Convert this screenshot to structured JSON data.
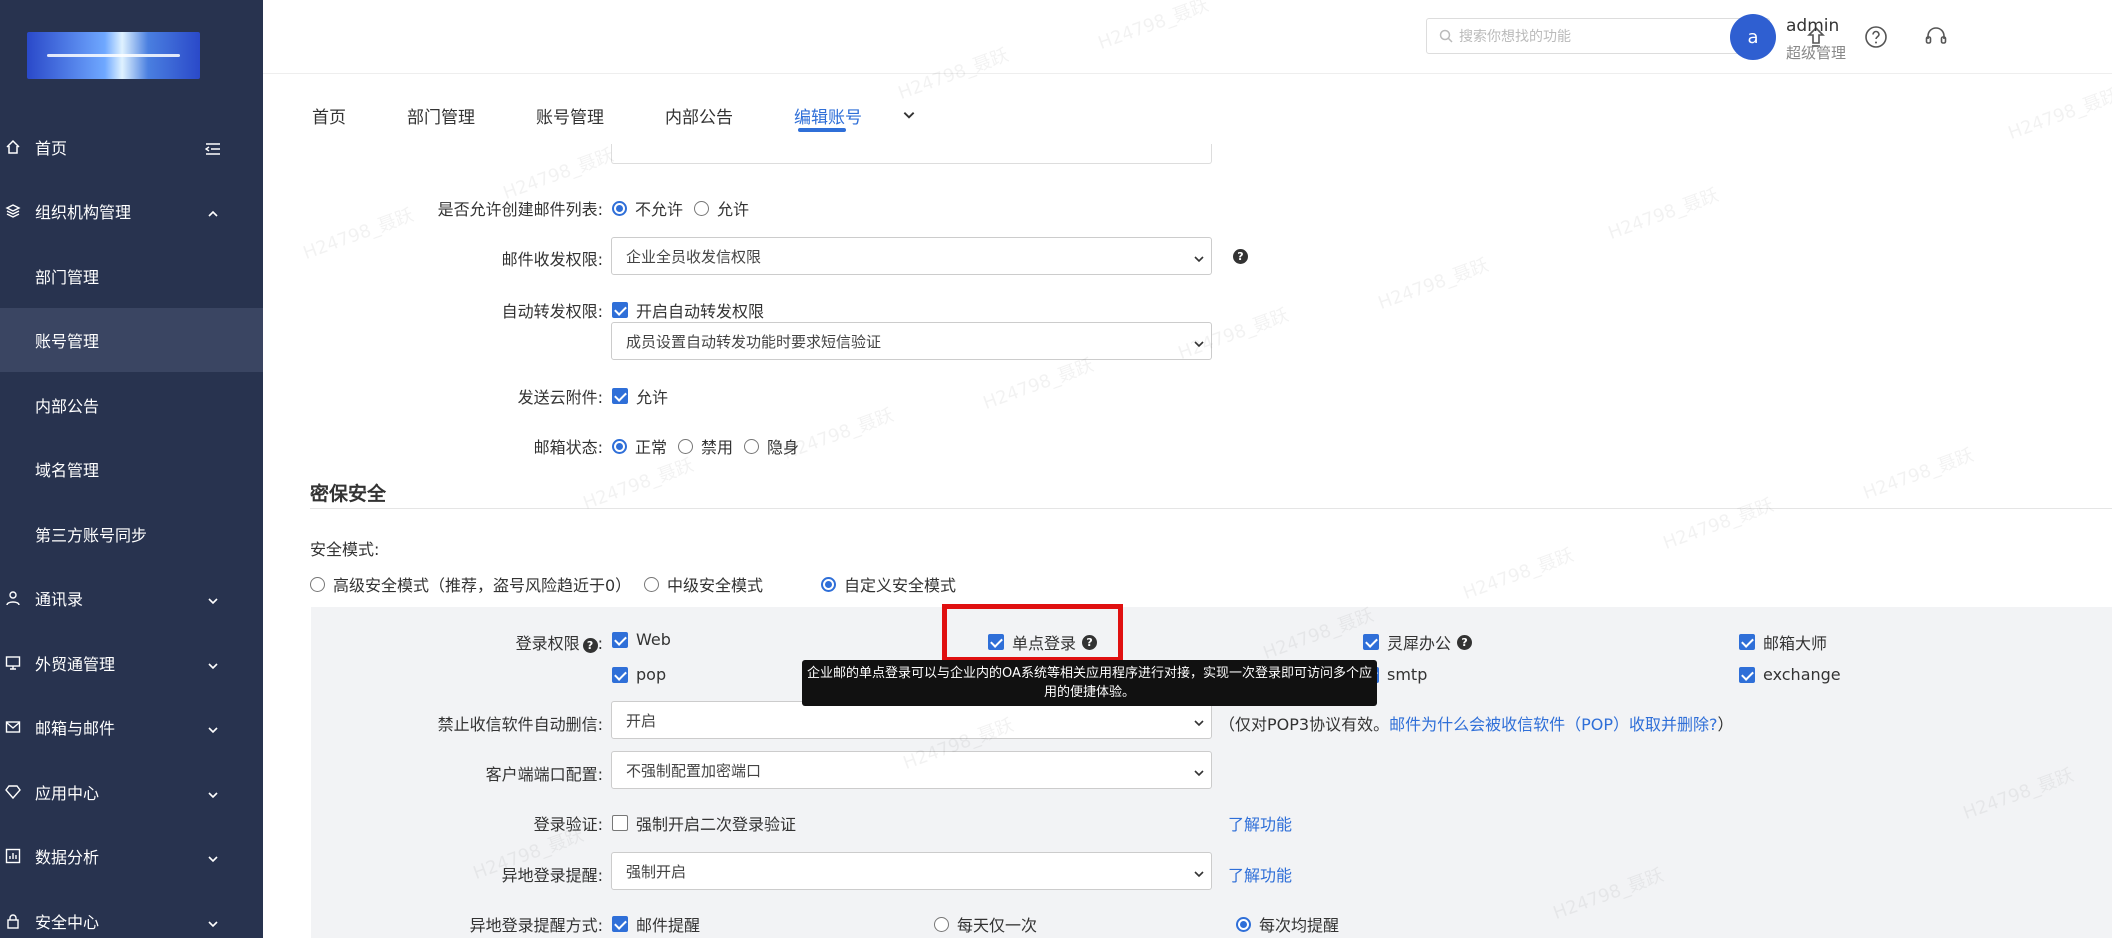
{
  "header": {
    "search_placeholder": "搜索你想找的功能",
    "avatar_letter": "a",
    "user_name": "admin",
    "user_role": "超级管理"
  },
  "sidebar": {
    "items": [
      {
        "label": "首页",
        "icon": "home-icon"
      },
      {
        "label": "组织机构管理",
        "icon": "layers-icon"
      },
      {
        "label": "部门管理"
      },
      {
        "label": "账号管理"
      },
      {
        "label": "内部公告"
      },
      {
        "label": "域名管理"
      },
      {
        "label": "第三方账号同步"
      },
      {
        "label": "通讯录",
        "icon": "person-icon"
      },
      {
        "label": "外贸通管理",
        "icon": "monitor-icon"
      },
      {
        "label": "邮箱与邮件",
        "icon": "mail-icon"
      },
      {
        "label": "应用中心",
        "icon": "diamond-icon"
      },
      {
        "label": "数据分析",
        "icon": "chart-icon"
      },
      {
        "label": "安全中心",
        "icon": "lock-icon"
      }
    ]
  },
  "tabs": [
    "首页",
    "部门管理",
    "账号管理",
    "内部公告",
    "编辑账号"
  ],
  "form": {
    "create_list_label": "是否允许创建邮件列表:",
    "create_list_opts": [
      "不允许",
      "允许"
    ],
    "mail_perm_label": "邮件收发权限:",
    "mail_perm_value": "企业全员收发信权限",
    "forward_label": "自动转发权限:",
    "forward_cb": "开启自动转发权限",
    "forward_select": "成员设置自动转发功能时要求短信验证",
    "cloud_label": "发送云附件:",
    "cloud_cb": "允许",
    "status_label": "邮箱状态:",
    "status_opts": [
      "正常",
      "禁用",
      "隐身"
    ]
  },
  "security": {
    "title": "密保安全",
    "mode_label": "安全模式:",
    "modes": [
      "高级安全模式（推荐，盗号风险趋近于0）",
      "中级安全模式",
      "自定义安全模式"
    ],
    "login_perm_label": "登录权限",
    "login_perms": [
      "Web",
      "单点登录",
      "灵犀办公",
      "邮箱大师",
      "pop",
      "smtp",
      "exchange"
    ],
    "tooltip": "企业邮的单点登录可以与企业内的OA系统等相关应用程序进行对接，实现一次登录即可访问多个应用的便捷体验。",
    "no_delete_label": "禁止收信软件自动删信:",
    "no_delete_value": "开启",
    "no_delete_note_prefix": "（仅对POP3协议有效。",
    "no_delete_link": "邮件为什么会被收信软件（POP）收取并删除?",
    "no_delete_note_suffix": "）",
    "client_port_label": "客户端端口配置:",
    "client_port_value": "不强制配置加密端口",
    "login_verify_label": "登录验证:",
    "login_verify_cb": "强制开启二次登录验证",
    "learn_more": "了解功能",
    "remote_label": "异地登录提醒:",
    "remote_value": "强制开启",
    "remote_method_label": "异地登录提醒方式:",
    "remote_method_cb": "邮件提醒",
    "remote_freq": [
      "每天仅一次",
      "每次均提醒"
    ]
  },
  "watermark": "H24798_聂跃",
  "colors": {
    "sidebar": "#28334f",
    "accent": "#2f6fd8",
    "highlight": "#e01010"
  }
}
